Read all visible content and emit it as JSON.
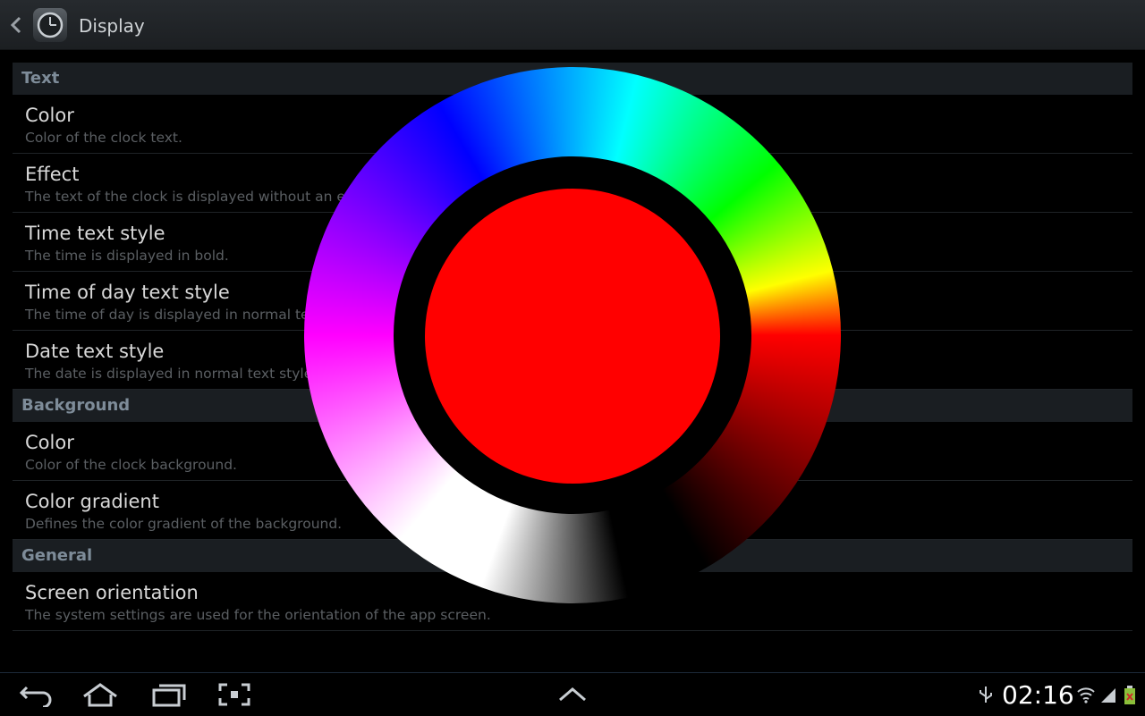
{
  "header": {
    "title": "Display",
    "icon": "clock-app-icon"
  },
  "sections": [
    {
      "label": "Text",
      "items": [
        {
          "title": "Color",
          "subtitle": "Color of the clock text."
        },
        {
          "title": "Effect",
          "subtitle": "The text of the clock is displayed without an effect."
        },
        {
          "title": "Time text style",
          "subtitle": "The time is displayed in bold."
        },
        {
          "title": "Time of day text style",
          "subtitle": "The time of day is displayed in normal text style."
        },
        {
          "title": "Date text style",
          "subtitle": "The date is displayed in normal text style."
        }
      ]
    },
    {
      "label": "Background",
      "items": [
        {
          "title": "Color",
          "subtitle": "Color of the clock background."
        },
        {
          "title": "Color gradient",
          "subtitle": "Defines the color gradient of the background."
        }
      ]
    },
    {
      "label": "General",
      "items": [
        {
          "title": "Screen orientation",
          "subtitle": "The system settings are used for the orientation of the app screen."
        }
      ]
    }
  ],
  "color_picker": {
    "selected_color": "#ff0000"
  },
  "statusbar": {
    "time": "02:16"
  },
  "colors": {
    "section_header_bg": "#1a1e22",
    "section_header_text": "#7e8c99",
    "accent": "#33b5e5"
  }
}
